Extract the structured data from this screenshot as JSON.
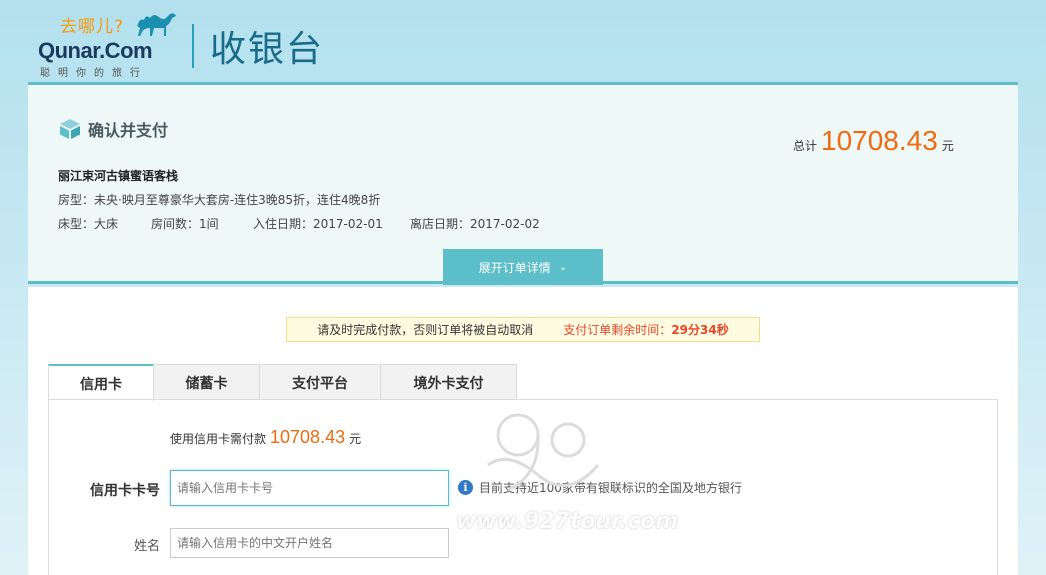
{
  "header": {
    "logo_slogan": "去哪儿?",
    "logo_brand": "Qunar.Com",
    "logo_sub": "聪明你的旅行",
    "page_title": "收银台"
  },
  "order": {
    "confirm_title": "确认并支付",
    "hotel_name": "丽江束河古镇蜜语客栈",
    "room_type": "房型：未央·映月至尊豪华大套房-连住3晚85折，连住4晚8折",
    "bed_type": "床型：大床",
    "room_count": "房间数：1间",
    "checkin": "入住日期：2017-02-01",
    "checkout": "离店日期：2017-02-02",
    "total_label": "总计",
    "total_amount": "10708.43",
    "total_unit": "元",
    "expand_label": "展开订单详情"
  },
  "notice": {
    "message": "请及时完成付款，否则订单将被自动取消",
    "timer_label": "支付订单剩余时间：",
    "timer_value": "29分34秒"
  },
  "tabs": [
    {
      "label": "信用卡"
    },
    {
      "label": "储蓄卡"
    },
    {
      "label": "支付平台"
    },
    {
      "label": "境外卡支付"
    }
  ],
  "payment": {
    "need_pay_label": "使用信用卡需付款",
    "need_pay_amount": "10708.43",
    "need_pay_unit": "元",
    "card_label": "信用卡卡号",
    "card_placeholder": "请输入信用卡卡号",
    "card_hint": "目前支持近100家带有银联标识的全国及地方银行",
    "name_label": "姓名",
    "name_placeholder": "请输入信用卡的中文开户姓名"
  },
  "watermark": {
    "text": "www.927tour.com"
  },
  "colors": {
    "accent": "#5bbec8",
    "price": "#f06a10",
    "timer": "#e8462c",
    "info": "#2f79c8"
  }
}
